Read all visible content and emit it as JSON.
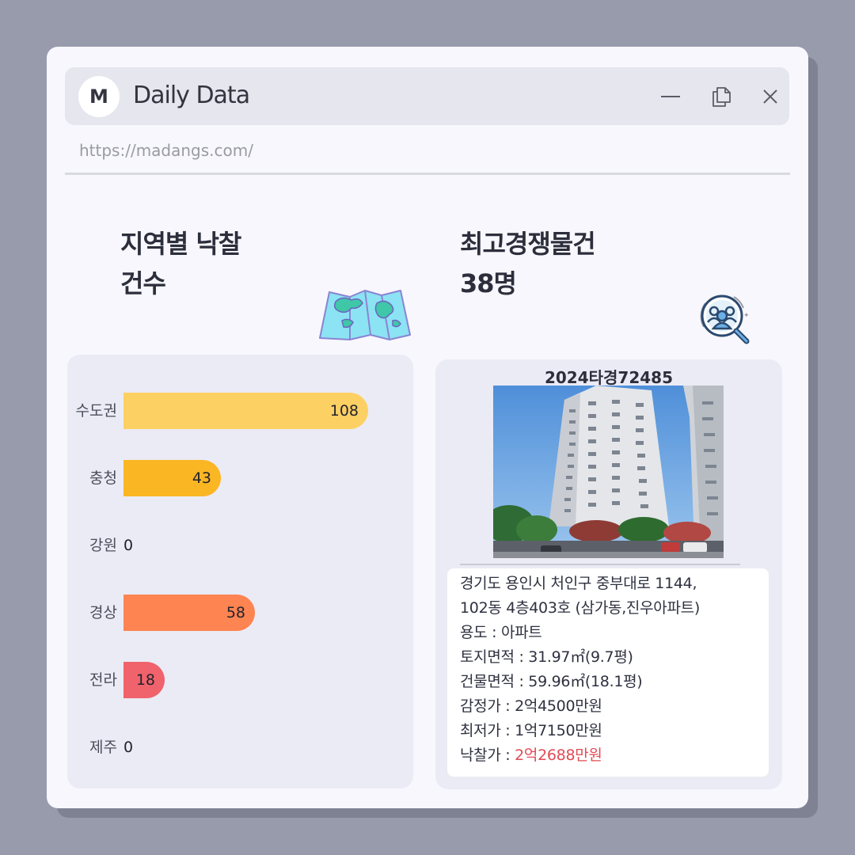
{
  "window": {
    "logo_letter": "M",
    "title": "Daily Data",
    "url": "https://madangs.com/"
  },
  "icons": {
    "logo": "m-logo-icon",
    "minimize": "minimize-icon",
    "restore": "restore-icon",
    "close": "close-icon",
    "map": "map-icon",
    "people_search": "people-search-icon"
  },
  "left_panel": {
    "heading_line1": "지역별 낙찰",
    "heading_line2": "건수"
  },
  "right_panel": {
    "heading_line1": "최고경쟁물건",
    "heading_line2": "38명",
    "case_number": "2024타경72485",
    "address_line1": "경기도 용인시 처인구 중부대로 1144,",
    "address_line2": "102동 4층403호 (삼가동,진우아파트)",
    "usage": "용도 : 아파트",
    "land_area": "토지면적 : 31.97㎡(9.7평)",
    "building_area": "건물면적 : 59.96㎡(18.1평)",
    "appraisal": "감정가 : 2억4500만원",
    "minimum": "최저가 : 1억7150만원",
    "winning_bid_label": "낙찰가 : ",
    "winning_bid_value": "2억2688만원"
  },
  "chart_data": {
    "type": "bar",
    "orientation": "horizontal",
    "categories": [
      "수도권",
      "충청",
      "강원",
      "경상",
      "전라",
      "제주"
    ],
    "values": [
      108,
      43,
      0,
      58,
      18,
      0
    ],
    "colors": [
      "#fdd063",
      "#fbb624",
      "#fbb624",
      "#fe8452",
      "#f0636c",
      "#f0636c"
    ],
    "xlim": [
      0,
      108
    ],
    "grid": false
  },
  "colors": {
    "background": "#989bac",
    "window": "#f7f7fd",
    "panel": "#ebebf5",
    "highlight": "#e24b55"
  }
}
